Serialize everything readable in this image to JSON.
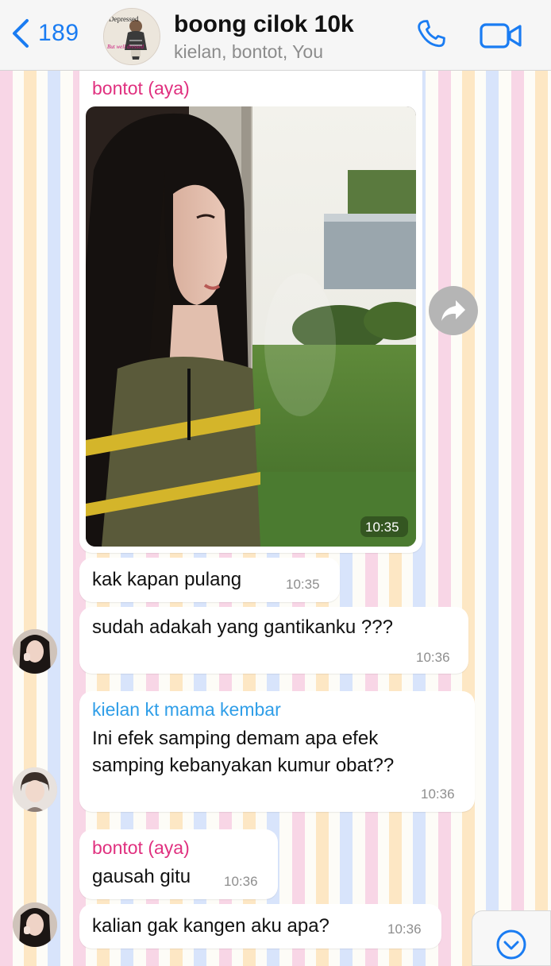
{
  "header": {
    "back_count": "189",
    "title": "boong cilok 10k",
    "subtitle": "kielan, bontot, You",
    "avatar_caption_top": "Depressed",
    "avatar_caption_bottom": "But well dressed"
  },
  "colors": {
    "accent": "#1a7cf2",
    "sender_pink": "#e0307f",
    "sender_blue": "#2f9ee8"
  },
  "messages": [
    {
      "type": "image",
      "sender": "bontot (aya)",
      "time": "10:35"
    },
    {
      "type": "text",
      "text": "kak kapan pulang",
      "time": "10:35"
    },
    {
      "type": "text",
      "text": "sudah adakah yang gantikanku ???",
      "time": "10:36"
    },
    {
      "type": "text",
      "sender": "kielan kt mama kembar",
      "text_line1": "Ini efek samping demam apa efek",
      "text_line2": "samping kebanyakan kumur obat??",
      "time": "10:36"
    },
    {
      "type": "text",
      "sender": "bontot (aya)",
      "text": "gausah gitu",
      "time": "10:36"
    },
    {
      "type": "text",
      "text": "kalian gak kangen aku apa?",
      "time": "10:36"
    }
  ],
  "icons": {
    "back": "chevron-left-icon",
    "call": "phone-icon",
    "video": "video-camera-icon",
    "forward": "forward-arrow-icon",
    "scroll": "chevron-down-circle-icon"
  }
}
